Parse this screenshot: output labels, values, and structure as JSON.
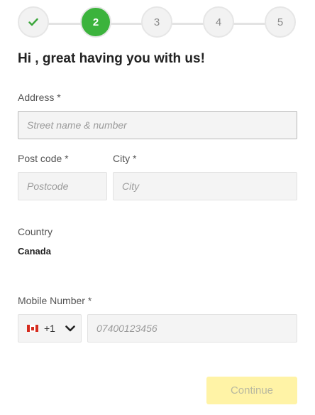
{
  "stepper": {
    "steps": [
      {
        "label": "",
        "state": "done",
        "icon": "check-icon"
      },
      {
        "label": "2",
        "state": "active"
      },
      {
        "label": "3",
        "state": "pending"
      },
      {
        "label": "4",
        "state": "pending"
      },
      {
        "label": "5",
        "state": "pending"
      }
    ],
    "accent_color": "#3bb33c"
  },
  "headline": "Hi , great having you with us!",
  "address": {
    "label": "Address *",
    "placeholder": "Street name & number",
    "value": ""
  },
  "postcode": {
    "label": "Post code *",
    "placeholder": "Postcode",
    "value": ""
  },
  "city": {
    "label": "City *",
    "placeholder": "City",
    "value": ""
  },
  "country": {
    "label": "Country",
    "value": "Canada"
  },
  "mobile": {
    "label": "Mobile Number *",
    "country_flag": "canada-flag-icon",
    "dial_code": "+1",
    "placeholder": "07400123456",
    "value": ""
  },
  "continue_button": {
    "label": "Continue",
    "background": "#fff3a6"
  }
}
